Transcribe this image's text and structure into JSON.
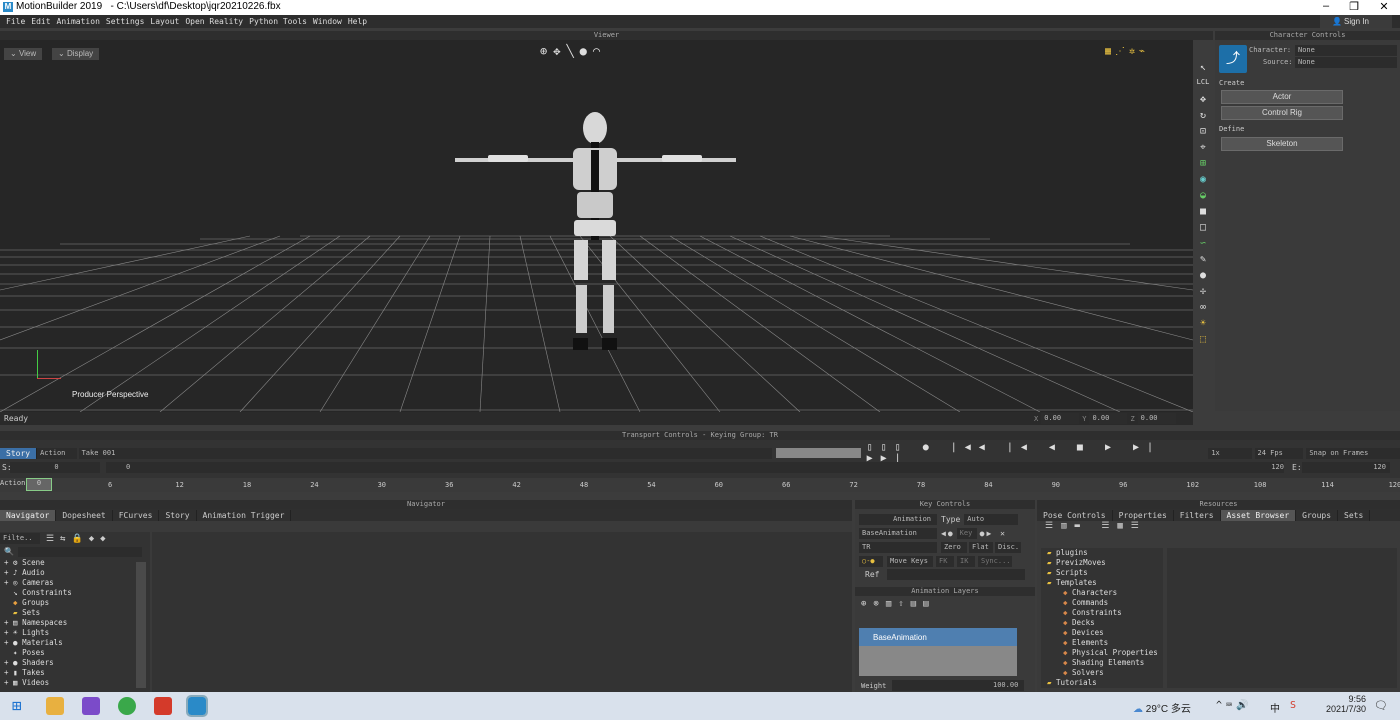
{
  "titlebar": {
    "app": "MotionBuilder 2019",
    "path": "- C:\\Users\\df\\Desktop\\jqr20210226.fbx",
    "min": "–",
    "max": "❐",
    "close": "✕"
  },
  "menu": [
    "File",
    "Edit",
    "Animation",
    "Settings",
    "Layout",
    "Open Reality",
    "Python Tools",
    "Window",
    "Help"
  ],
  "signin": "Sign In",
  "viewer": {
    "title": "Viewer",
    "view": "View",
    "display": "Display",
    "camera": "Producer Perspective"
  },
  "charctl": {
    "title": "Character Controls",
    "character_label": "Character:",
    "character_val": "None",
    "source_label": "Source:",
    "source_val": "None",
    "create": "Create",
    "actor": "Actor",
    "control_rig": "Control Rig",
    "define": "Define",
    "skeleton": "Skeleton"
  },
  "status": {
    "ready": "Ready",
    "x": "X",
    "xv": "0.00",
    "y": "Y",
    "yv": "0.00",
    "z": "Z",
    "zv": "0.00"
  },
  "transport": {
    "title": "Transport Controls  -  Keying Group: TR",
    "story": "Story",
    "action": "Action",
    "take": "Take 001",
    "speed": "1x",
    "fps": "24 Fps",
    "snap": "Snap on Frames",
    "s_label": "S:",
    "s_val": "0",
    "cur": "0",
    "end": "120",
    "e_label": "E:",
    "e_val": "120",
    "ruler_label": "Action",
    "ruler_frame": "0"
  },
  "ruler_ticks": [
    "6",
    "12",
    "18",
    "24",
    "30",
    "36",
    "42",
    "48",
    "54",
    "60",
    "66",
    "72",
    "78",
    "84",
    "90",
    "96",
    "102",
    "108",
    "114",
    "120"
  ],
  "navigator": {
    "title": "Navigator",
    "tabs": [
      "Navigator",
      "Dopesheet",
      "FCurves",
      "Story",
      "Animation Trigger"
    ],
    "filter": "Filte..",
    "tree": [
      "Scene",
      "Audio",
      "Cameras",
      "Constraints",
      "Groups",
      "Sets",
      "Namespaces",
      "Lights",
      "Materials",
      "Poses",
      "Shaders",
      "Takes",
      "Videos"
    ]
  },
  "keyctl": {
    "title": "Key Controls",
    "animation": "Animation",
    "type_label": "Type",
    "type_val": "Auto",
    "layer": "BaseAnimation",
    "key": "Key",
    "tr": "TR",
    "zero": "Zero",
    "flat": "Flat",
    "disc": "Disc.",
    "move_keys": "Move Keys",
    "fk": "FK",
    "ik": "IK",
    "sync": "Sync...",
    "ref": "Ref",
    "layers_title": "Animation Layers",
    "base": "BaseAnimation",
    "weight": "Weight",
    "weight_val": "100.00"
  },
  "resources": {
    "title": "Resources",
    "tabs": [
      "Pose Controls",
      "Properties",
      "Filters",
      "Asset Browser",
      "Groups",
      "Sets"
    ],
    "tree": [
      {
        "t": "plugins",
        "l": 0
      },
      {
        "t": "PrevizMoves",
        "l": 0
      },
      {
        "t": "Scripts",
        "l": 0
      },
      {
        "t": "Templates",
        "l": 0
      },
      {
        "t": "Characters",
        "l": 1
      },
      {
        "t": "Commands",
        "l": 1
      },
      {
        "t": "Constraints",
        "l": 1
      },
      {
        "t": "Decks",
        "l": 1
      },
      {
        "t": "Devices",
        "l": 1
      },
      {
        "t": "Elements",
        "l": 1
      },
      {
        "t": "Physical Properties",
        "l": 1
      },
      {
        "t": "Shading Elements",
        "l": 1
      },
      {
        "t": "Solvers",
        "l": 1
      },
      {
        "t": "Tutorials",
        "l": 0
      }
    ]
  },
  "taskbar": {
    "weather": "29°C 多云",
    "ime": "中",
    "time": "9:56",
    "date": "2021/7/30"
  }
}
